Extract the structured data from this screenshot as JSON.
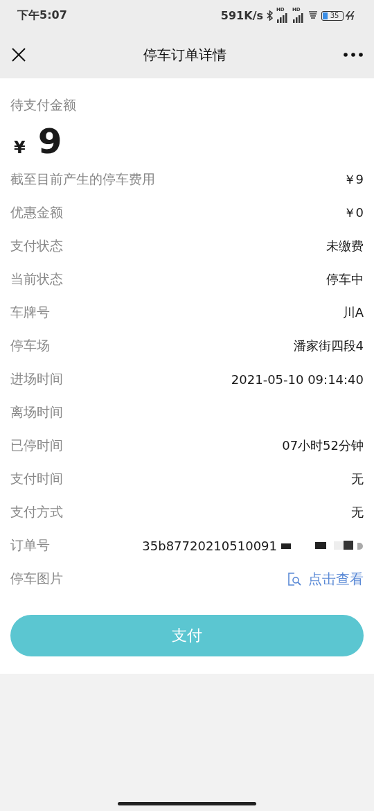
{
  "status_bar": {
    "time": "下午5:07",
    "speed": "591K/s",
    "signal_tags": [
      "HD",
      "HD"
    ],
    "battery": "35"
  },
  "nav": {
    "title": "停车订单详情"
  },
  "amount": {
    "label": "待支付金额",
    "currency": "¥",
    "value": "9"
  },
  "rows": [
    {
      "kind": "text",
      "label": "截至目前产生的停车费用",
      "value": "￥9"
    },
    {
      "kind": "text",
      "label": "优惠金额",
      "value": "￥0"
    },
    {
      "kind": "text",
      "label": "支付状态",
      "value": "未缴费"
    },
    {
      "kind": "text",
      "label": "当前状态",
      "value": "停车中"
    },
    {
      "kind": "text",
      "label": "车牌号",
      "value": "川A"
    },
    {
      "kind": "text",
      "label": "停车场",
      "value": "潘家街四段4"
    },
    {
      "kind": "text",
      "label": "进场时间",
      "value": "2021-05-10 09:14:40"
    },
    {
      "kind": "text",
      "label": "离场时间"
    },
    {
      "kind": "text",
      "label": "已停时间",
      "value": "07小时52分钟"
    },
    {
      "kind": "text",
      "label": "支付时间",
      "value": "无"
    },
    {
      "kind": "text",
      "label": "支付方式",
      "value": "无"
    },
    {
      "kind": "redacted",
      "label": "订单号",
      "value": "35b87720210510091"
    },
    {
      "kind": "link",
      "label": "停车图片",
      "value": "点击查看"
    }
  ],
  "pay_button": {
    "label": "支付"
  }
}
